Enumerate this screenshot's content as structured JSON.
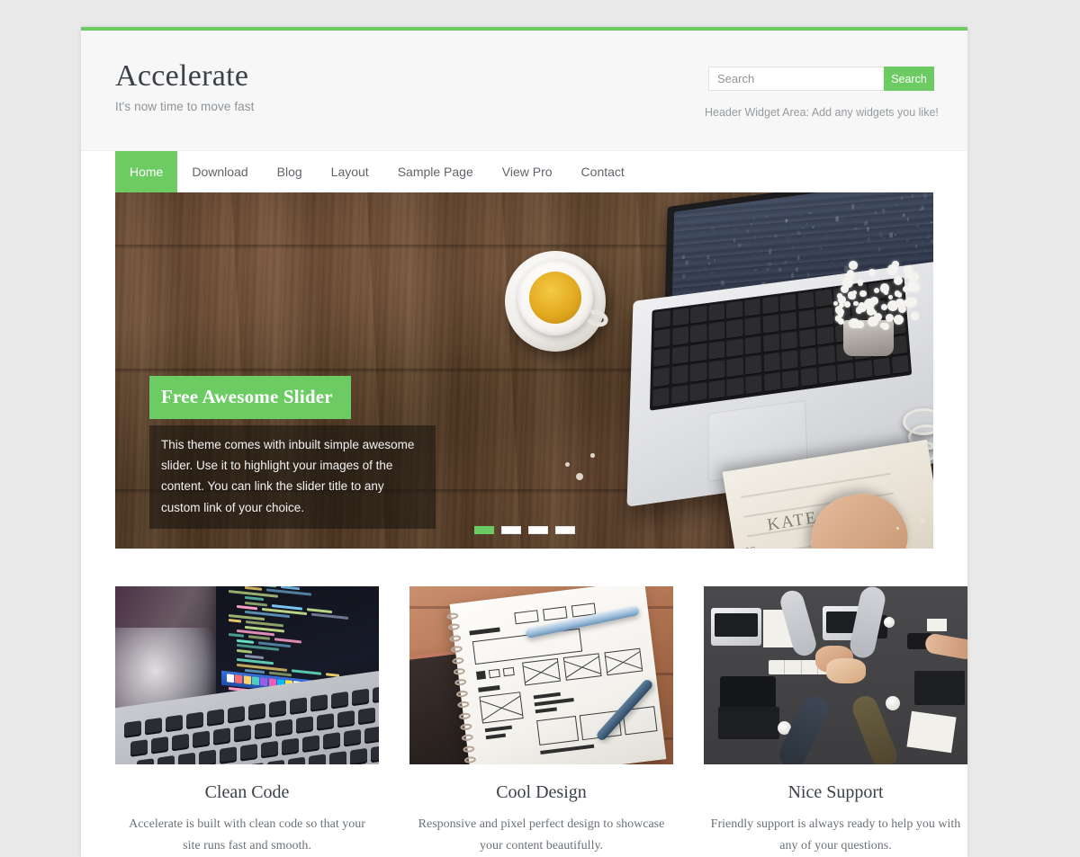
{
  "theme": {
    "accent_green": "#6ccc63",
    "page_background": "#e9e9e9",
    "header_background": "#f7f7f7",
    "content_background": "#ffffff",
    "title_color": "#3b4147",
    "muted_text_color": "#8d9499"
  },
  "header": {
    "site_title": "Accelerate",
    "tagline": "It's now time to move fast",
    "search": {
      "placeholder": "Search",
      "value": "",
      "button_label": "Search"
    },
    "widget_area_note": "Header Widget Area: Add any widgets you like!"
  },
  "nav": {
    "items": [
      {
        "label": "Home",
        "active": true
      },
      {
        "label": "Download",
        "active": false
      },
      {
        "label": "Blog",
        "active": false
      },
      {
        "label": "Layout",
        "active": false
      },
      {
        "label": "Sample Page",
        "active": false
      },
      {
        "label": "View Pro",
        "active": false
      },
      {
        "label": "Contact",
        "active": false
      }
    ]
  },
  "slider": {
    "image_description": "Top-down photo of a dark walnut wooden desk with an open silver laptop, a white cup of tea on a saucer, baby's breath flowers in a small pot, silver bangles and an open notebook with a hand writing",
    "slide_title": "Free Awesome Slider",
    "slide_text": "This theme comes with inbuilt simple awesome slider. Use it to highlight your images of the content. You can link the slider title to any custom link of your choice.",
    "dots": [
      {
        "index": 1,
        "active": true
      },
      {
        "index": 2,
        "active": false
      },
      {
        "index": 3,
        "active": false
      },
      {
        "index": 4,
        "active": false
      }
    ]
  },
  "features": [
    {
      "title": "Clean Code",
      "text": "Accelerate is built with clean code so that your site runs fast and smooth.",
      "image_description": "Close-up of a laptop screen displaying colorful source code in a dark editor"
    },
    {
      "title": "Cool Design",
      "text": "Responsive and pixel perfect design to showcase your content beautifully.",
      "image_description": "Spiral notebook with hand drawn website wireframe sketches, pens and a smartphone on a wooden table"
    },
    {
      "title": "Nice Support",
      "text": "Friendly support is always ready to help you with any of your questions.",
      "image_description": "Overhead view of a team stacking hands together over a wooden desk with laptops, phones and notebooks"
    }
  ]
}
